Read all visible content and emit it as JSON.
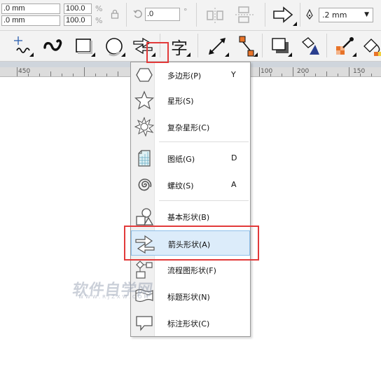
{
  "property_bar": {
    "x_value": ".0 mm",
    "y_value": ".0 mm",
    "scale_x": "100.0",
    "scale_y": "100.0",
    "percent_symbol": "%",
    "rotation": ".0",
    "degree_symbol": "°",
    "outline_width": ".2 mm"
  },
  "ruler": {
    "labels": [
      "450",
      "100",
      "150",
      "200",
      "150"
    ]
  },
  "toolbox": {
    "text_tool_glyph": "字"
  },
  "menu": {
    "items": [
      {
        "label": "多边形(P)",
        "shortcut": "Y",
        "icon": "polygon-icon"
      },
      {
        "label": "星形(S)",
        "shortcut": "",
        "icon": "star-icon"
      },
      {
        "label": "复杂星形(C)",
        "shortcut": "",
        "icon": "complex-star-icon"
      },
      {
        "label": "图纸(G)",
        "shortcut": "D",
        "icon": "graph-paper-icon"
      },
      {
        "label": "螺纹(S)",
        "shortcut": "A",
        "icon": "spiral-icon"
      },
      {
        "label": "基本形状(B)",
        "shortcut": "",
        "icon": "basic-shapes-icon"
      },
      {
        "label": "箭头形状(A)",
        "shortcut": "",
        "icon": "arrow-shapes-icon"
      },
      {
        "label": "流程图形状(F)",
        "shortcut": "",
        "icon": "flowchart-shapes-icon"
      },
      {
        "label": "标题形状(N)",
        "shortcut": "",
        "icon": "banner-shapes-icon"
      },
      {
        "label": "标注形状(C)",
        "shortcut": "",
        "icon": "callout-shapes-icon"
      }
    ]
  },
  "watermark": {
    "text": "软件自学网",
    "sub": "WWW.RJZXW.COM"
  }
}
